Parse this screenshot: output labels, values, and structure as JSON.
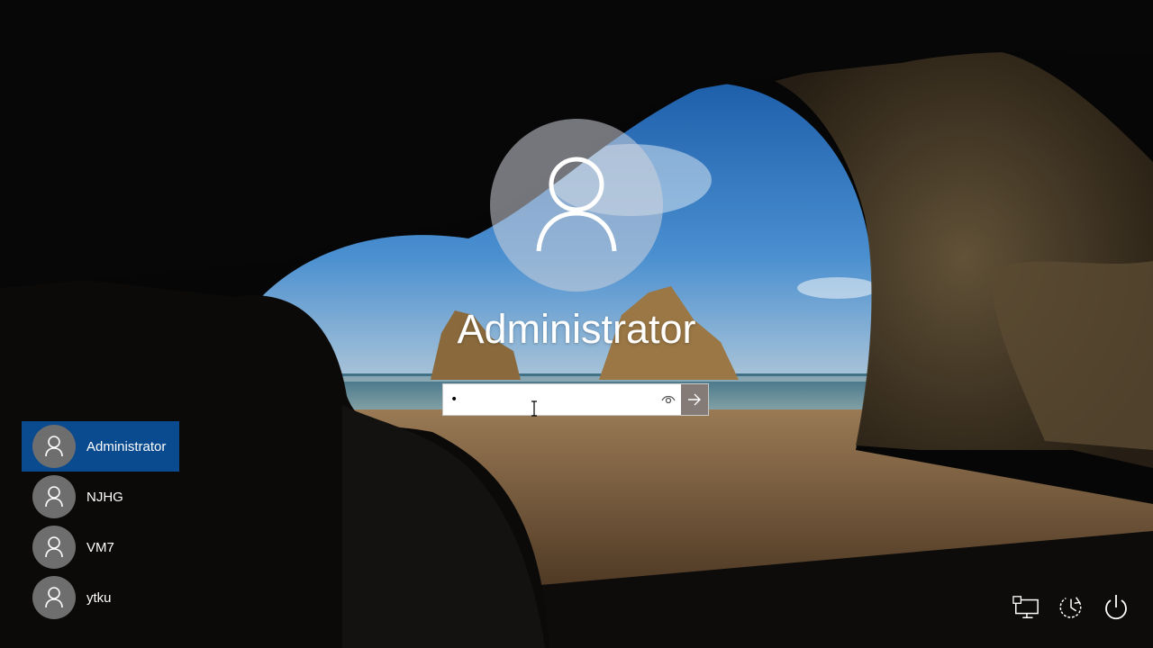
{
  "login": {
    "selected_user": "Administrator",
    "password_value": "•",
    "avatar_icon": "user-silhouette-icon",
    "reveal_icon": "eye-icon",
    "submit_icon": "arrow-right-icon"
  },
  "users": [
    {
      "name": "Administrator",
      "selected": true
    },
    {
      "name": "NJHG",
      "selected": false
    },
    {
      "name": "VM7",
      "selected": false
    },
    {
      "name": "ytku",
      "selected": false
    }
  ],
  "bottom_bar": {
    "icons": [
      "network-icon",
      "ease-of-access-icon",
      "power-icon"
    ]
  },
  "colors": {
    "selected_user_bg": "#0a4b8f",
    "sky": "#2f6fb8",
    "sand": "#8a6a45"
  }
}
